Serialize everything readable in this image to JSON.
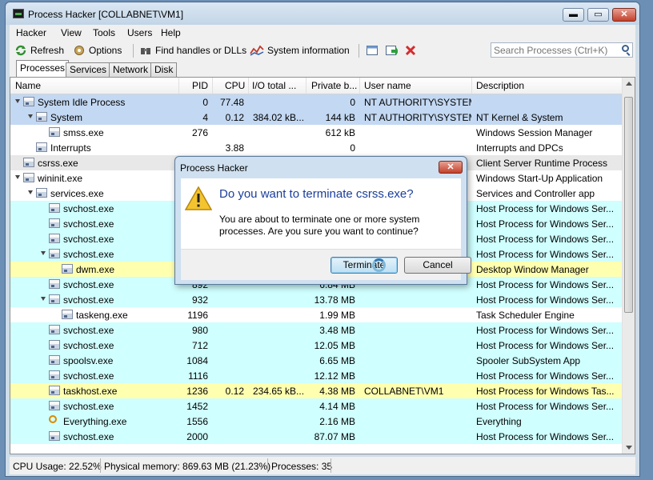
{
  "window": {
    "title": "Process Hacker [COLLABNET\\VM1]",
    "min_glyph": "▬",
    "max_glyph": "▭",
    "close_glyph": "✕"
  },
  "menu": [
    "Hacker",
    "View",
    "Tools",
    "Users",
    "Help"
  ],
  "toolbar": {
    "refresh_label": "Refresh",
    "options_label": "Options",
    "find_label": "Find handles or DLLs",
    "sysinfo_label": "System information",
    "search_placeholder": "Search Processes (Ctrl+K)"
  },
  "tabs": [
    "Processes",
    "Services",
    "Network",
    "Disk"
  ],
  "columns": [
    "Name",
    "PID",
    "CPU",
    "I/O total ...",
    "Private b...",
    "User name",
    "Description"
  ],
  "colors": {
    "system_row": "#c3d8f2",
    "service_row": "#d0ffff",
    "own_process_row": "#ffffb0",
    "default_row": "#ffffff"
  },
  "processes": [
    {
      "name": "System Idle Process",
      "pid": "0",
      "cpu": "77.48",
      "io": "",
      "private": "0",
      "user": "NT AUTHORITY\\SYSTEM",
      "desc": "",
      "depth": 0,
      "expander": true,
      "color": "system",
      "icon": "window-icon"
    },
    {
      "name": "System",
      "pid": "4",
      "cpu": "0.12",
      "io": "384.02 kB...",
      "private": "144 kB",
      "user": "NT AUTHORITY\\SYSTEM",
      "desc": "NT Kernel & System",
      "depth": 1,
      "expander": true,
      "color": "system",
      "icon": "window-icon"
    },
    {
      "name": "smss.exe",
      "pid": "276",
      "cpu": "",
      "io": "",
      "private": "612 kB",
      "user": "",
      "desc": "Windows Session Manager",
      "depth": 2,
      "expander": false,
      "color": "default",
      "icon": "window-icon"
    },
    {
      "name": "Interrupts",
      "pid": "",
      "cpu": "3.88",
      "io": "",
      "private": "0",
      "user": "",
      "desc": "Interrupts and DPCs",
      "depth": 1,
      "expander": false,
      "color": "default",
      "icon": "window-icon"
    },
    {
      "name": "csrss.exe",
      "pid": "",
      "cpu": "",
      "io": "",
      "private": "",
      "user": "",
      "desc": "Client Server Runtime Process",
      "depth": 0,
      "expander": false,
      "color": "selected",
      "icon": "window-icon"
    },
    {
      "name": "wininit.exe",
      "pid": "",
      "cpu": "",
      "io": "",
      "private": "",
      "user": "",
      "desc": "Windows Start-Up Application",
      "depth": 0,
      "expander": true,
      "color": "default",
      "icon": "window-icon"
    },
    {
      "name": "services.exe",
      "pid": "",
      "cpu": "",
      "io": "",
      "private": "",
      "user": "",
      "desc": "Services and Controller app",
      "depth": 1,
      "expander": true,
      "color": "default",
      "icon": "window-icon"
    },
    {
      "name": "svchost.exe",
      "pid": "",
      "cpu": "",
      "io": "",
      "private": "",
      "user": "",
      "desc": "Host Process for Windows Ser...",
      "depth": 2,
      "expander": false,
      "color": "service",
      "icon": "window-icon"
    },
    {
      "name": "svchost.exe",
      "pid": "",
      "cpu": "",
      "io": "",
      "private": "",
      "user": "",
      "desc": "Host Process for Windows Ser...",
      "depth": 2,
      "expander": false,
      "color": "service",
      "icon": "window-icon"
    },
    {
      "name": "svchost.exe",
      "pid": "",
      "cpu": "",
      "io": "",
      "private": "",
      "user": "",
      "desc": "Host Process for Windows Ser...",
      "depth": 2,
      "expander": false,
      "color": "service",
      "icon": "window-icon"
    },
    {
      "name": "svchost.exe",
      "pid": "",
      "cpu": "",
      "io": "",
      "private": "",
      "user": "",
      "desc": "Host Process for Windows Ser...",
      "depth": 2,
      "expander": true,
      "color": "service",
      "icon": "window-icon"
    },
    {
      "name": "dwm.exe",
      "pid": "",
      "cpu": "",
      "io": "",
      "private": "",
      "user": "",
      "desc": "Desktop Window Manager",
      "depth": 3,
      "expander": false,
      "color": "own",
      "icon": "window-icon"
    },
    {
      "name": "svchost.exe",
      "pid": "892",
      "cpu": "",
      "io": "",
      "private": "6.84 MB",
      "user": "",
      "desc": "Host Process for Windows Ser...",
      "depth": 2,
      "expander": false,
      "color": "service",
      "icon": "window-icon"
    },
    {
      "name": "svchost.exe",
      "pid": "932",
      "cpu": "",
      "io": "",
      "private": "13.78 MB",
      "user": "",
      "desc": "Host Process for Windows Ser...",
      "depth": 2,
      "expander": true,
      "color": "service",
      "icon": "window-icon"
    },
    {
      "name": "taskeng.exe",
      "pid": "1196",
      "cpu": "",
      "io": "",
      "private": "1.99 MB",
      "user": "",
      "desc": "Task Scheduler Engine",
      "depth": 3,
      "expander": false,
      "color": "default",
      "icon": "window-icon"
    },
    {
      "name": "svchost.exe",
      "pid": "980",
      "cpu": "",
      "io": "",
      "private": "3.48 MB",
      "user": "",
      "desc": "Host Process for Windows Ser...",
      "depth": 2,
      "expander": false,
      "color": "service",
      "icon": "window-icon"
    },
    {
      "name": "svchost.exe",
      "pid": "712",
      "cpu": "",
      "io": "",
      "private": "12.05 MB",
      "user": "",
      "desc": "Host Process for Windows Ser...",
      "depth": 2,
      "expander": false,
      "color": "service",
      "icon": "window-icon"
    },
    {
      "name": "spoolsv.exe",
      "pid": "1084",
      "cpu": "",
      "io": "",
      "private": "6.65 MB",
      "user": "",
      "desc": "Spooler SubSystem App",
      "depth": 2,
      "expander": false,
      "color": "service",
      "icon": "window-icon"
    },
    {
      "name": "svchost.exe",
      "pid": "1116",
      "cpu": "",
      "io": "",
      "private": "12.12 MB",
      "user": "",
      "desc": "Host Process for Windows Ser...",
      "depth": 2,
      "expander": false,
      "color": "service",
      "icon": "window-icon"
    },
    {
      "name": "taskhost.exe",
      "pid": "1236",
      "cpu": "0.12",
      "io": "234.65 kB...",
      "private": "4.38 MB",
      "user": "COLLABNET\\VM1",
      "desc": "Host Process for Windows Tas...",
      "depth": 2,
      "expander": false,
      "color": "own",
      "icon": "window-icon"
    },
    {
      "name": "svchost.exe",
      "pid": "1452",
      "cpu": "",
      "io": "",
      "private": "4.14 MB",
      "user": "",
      "desc": "Host Process for Windows Ser...",
      "depth": 2,
      "expander": false,
      "color": "service",
      "icon": "window-icon"
    },
    {
      "name": "Everything.exe",
      "pid": "1556",
      "cpu": "",
      "io": "",
      "private": "2.16 MB",
      "user": "",
      "desc": "Everything",
      "depth": 2,
      "expander": false,
      "color": "service",
      "icon": "magnifier-icon"
    },
    {
      "name": "svchost.exe",
      "pid": "2000",
      "cpu": "",
      "io": "",
      "private": "87.07 MB",
      "user": "",
      "desc": "Host Process for Windows Ser...",
      "depth": 2,
      "expander": false,
      "color": "service",
      "icon": "window-icon"
    }
  ],
  "status": {
    "cpu": "CPU Usage: 22.52%",
    "memory": "Physical memory: 869.63 MB (21.23%)",
    "processes": "Processes: 35"
  },
  "dialog": {
    "title": "Process Hacker",
    "close_glyph": "✕",
    "heading": "Do you want to terminate csrss.exe?",
    "message": "You are about to terminate one or more system processes. Are you sure you want to continue?",
    "terminate_label": "Terminate",
    "cancel_label": "Cancel"
  }
}
